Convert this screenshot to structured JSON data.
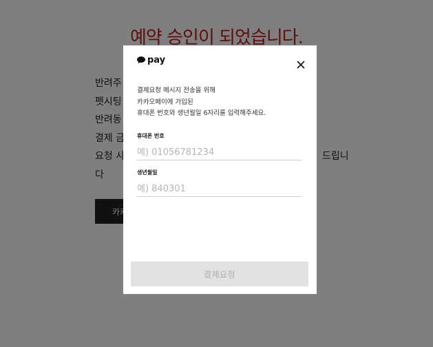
{
  "background": {
    "heading": "예약 승인이 되었습니다.",
    "lines": [
      "반려주",
      "펫시팅",
      "반려동",
      "결제 금",
      "요청 사",
      "다"
    ],
    "line_tail": "드립니",
    "button_label": "카카",
    "heading_color": "#c11a1a"
  },
  "modal": {
    "brand": "pay",
    "brand_icon": "speech-bubble-icon",
    "close_icon": "close-icon",
    "description": [
      "결제요청 메시지 전송을 위해",
      "카카오페이에 가입된",
      "휴대폰 번호와 생년월일 6자리를 입력해주세요."
    ],
    "phone": {
      "label": "휴대폰 번호",
      "placeholder": "예) 01056781234",
      "value": ""
    },
    "birth": {
      "label": "생년월일",
      "placeholder": "예) 840301",
      "value": ""
    },
    "submit_label": "결제요청"
  }
}
